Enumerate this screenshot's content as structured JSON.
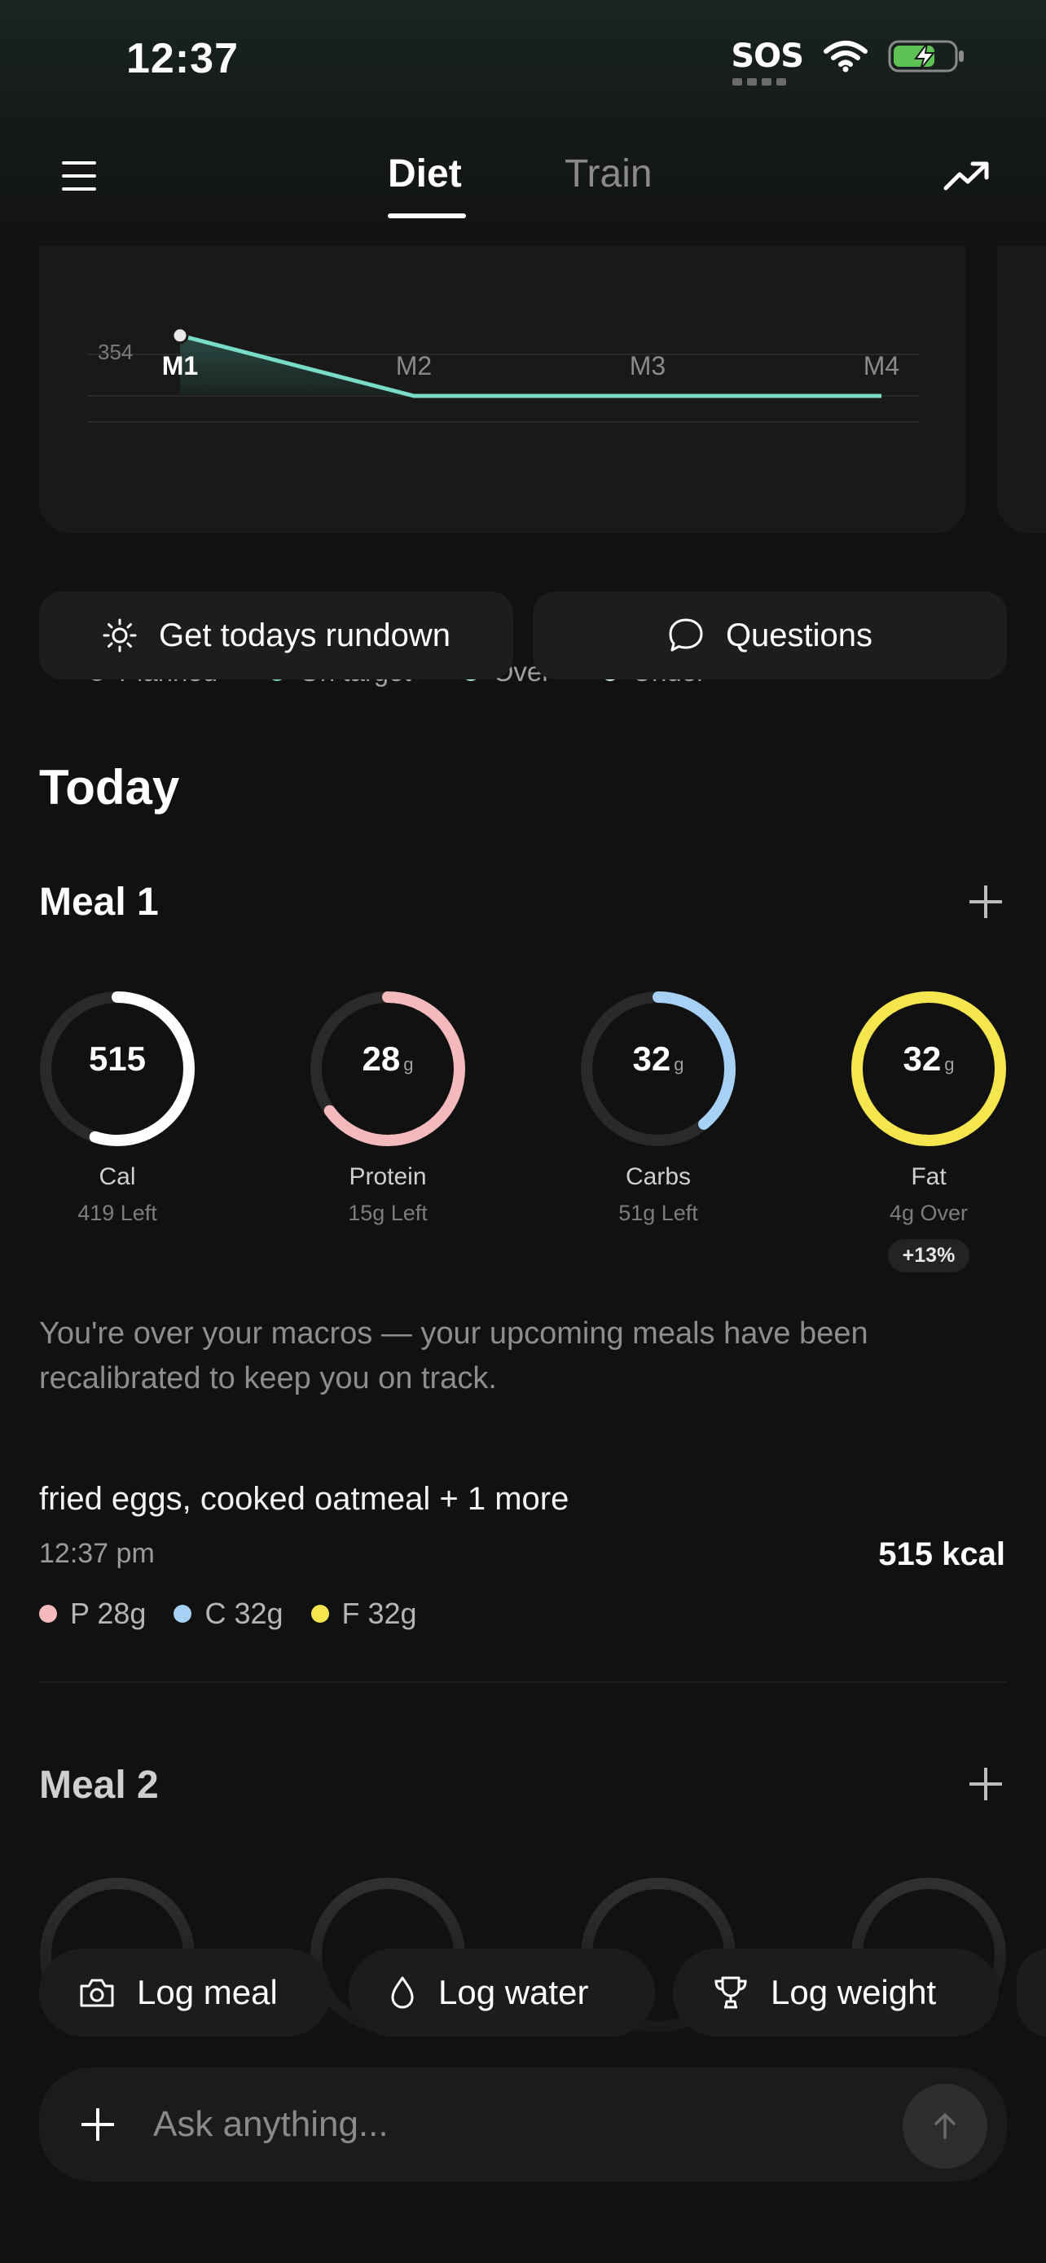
{
  "status": {
    "time": "12:37",
    "sos": "SOS"
  },
  "header": {
    "tabs": [
      "Diet",
      "Train"
    ],
    "active_tab": "Diet"
  },
  "chart_data": {
    "type": "line",
    "categories": [
      "M1",
      "M2",
      "M3",
      "M4"
    ],
    "y_ticks": [
      "354"
    ],
    "values": [
      515,
      0,
      0,
      0
    ],
    "legend": [
      {
        "label": "Planned",
        "color": "#7a7a7a"
      },
      {
        "label": "On target",
        "color": "#6fd9c1"
      },
      {
        "label": "Over",
        "color": "#a9ede0"
      },
      {
        "label": "Under",
        "color": "#d5f7f0"
      }
    ]
  },
  "actions": {
    "rundown": "Get todays rundown",
    "questions": "Questions"
  },
  "today": {
    "heading": "Today"
  },
  "meal1": {
    "title": "Meal 1",
    "rings": [
      {
        "value": "515",
        "unit": "",
        "label": "Cal",
        "sub": "419 Left",
        "color": "#ffffff",
        "progress": 0.55
      },
      {
        "value": "28",
        "unit": "g",
        "label": "Protein",
        "sub": "15g Left",
        "color": "#f3b9bd",
        "progress": 0.65
      },
      {
        "value": "32",
        "unit": "g",
        "label": "Carbs",
        "sub": "51g Left",
        "color": "#a6d1f5",
        "progress": 0.39
      },
      {
        "value": "32",
        "unit": "g",
        "label": "Fat",
        "sub": "4g Over",
        "color": "#f5e64f",
        "progress": 1.0,
        "badge": "+13%"
      }
    ],
    "note": "You're over your macros — your upcoming meals have been recalibrated to keep you on track.",
    "entry": {
      "title": "fried eggs, cooked oatmeal + 1 more",
      "time": "12:37 pm",
      "kcal": "515 kcal",
      "macros": [
        {
          "text": "P 28g",
          "color": "#f3b9bd"
        },
        {
          "text": "C 32g",
          "color": "#a6d1f5"
        },
        {
          "text": "F 32g",
          "color": "#f5e64f"
        }
      ]
    }
  },
  "meal2": {
    "title": "Meal 2"
  },
  "quick_actions": {
    "log_meal": "Log meal",
    "log_water": "Log water",
    "log_weight": "Log weight"
  },
  "composer": {
    "placeholder": "Ask anything..."
  }
}
